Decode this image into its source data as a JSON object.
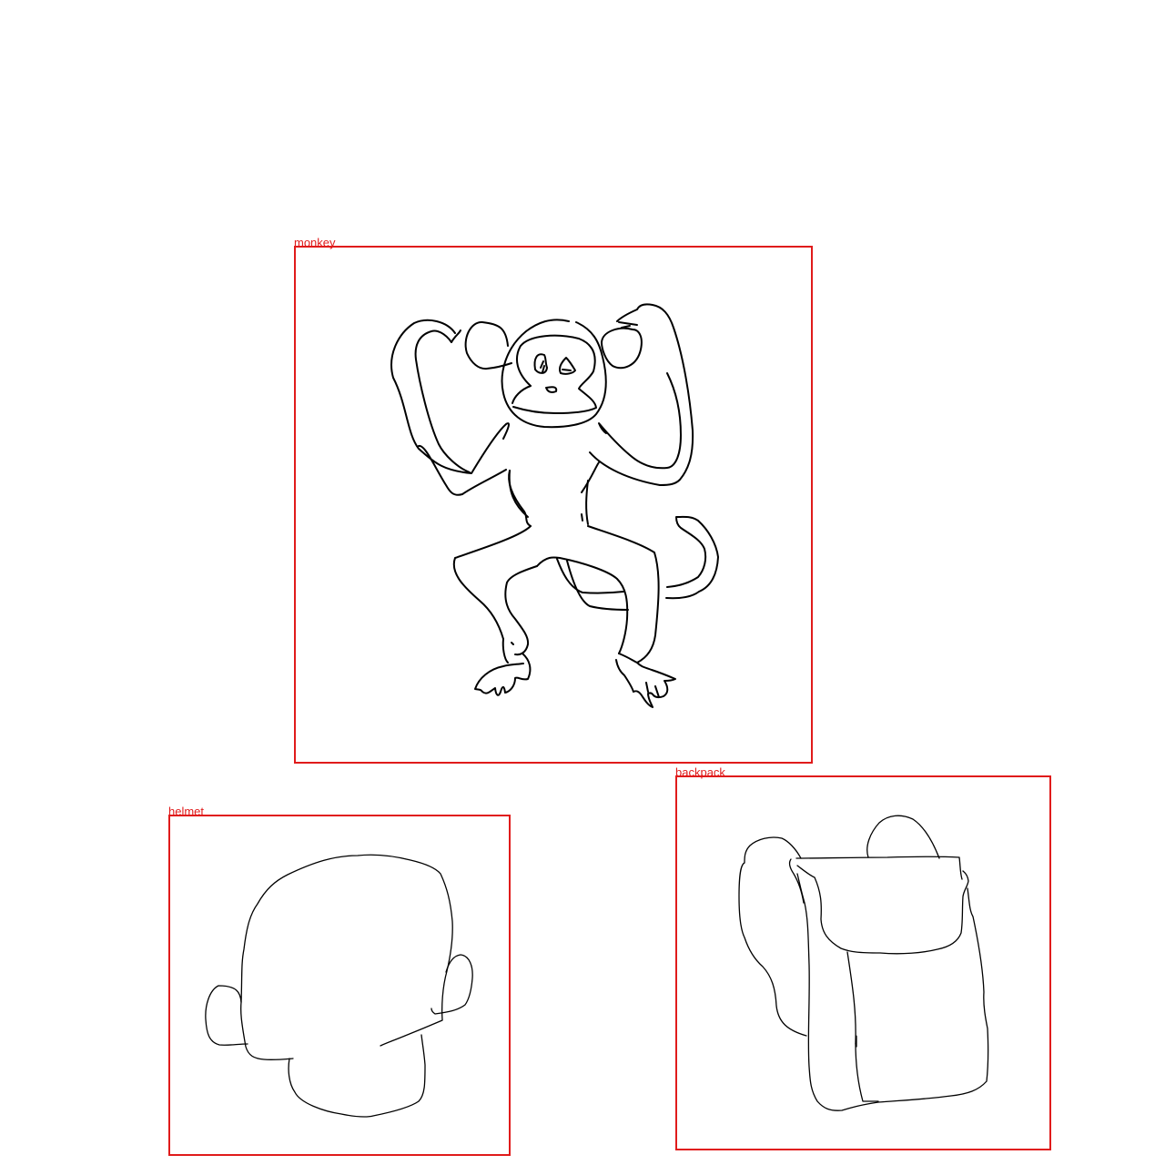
{
  "annotation_color": "#e01b1b",
  "stroke_color": "#000000",
  "detections": [
    {
      "label": "monkey",
      "icon": "monkey-sketch"
    },
    {
      "label": "helmet",
      "icon": "helmet-sketch"
    },
    {
      "label": "backpack",
      "icon": "backpack-sketch"
    }
  ]
}
